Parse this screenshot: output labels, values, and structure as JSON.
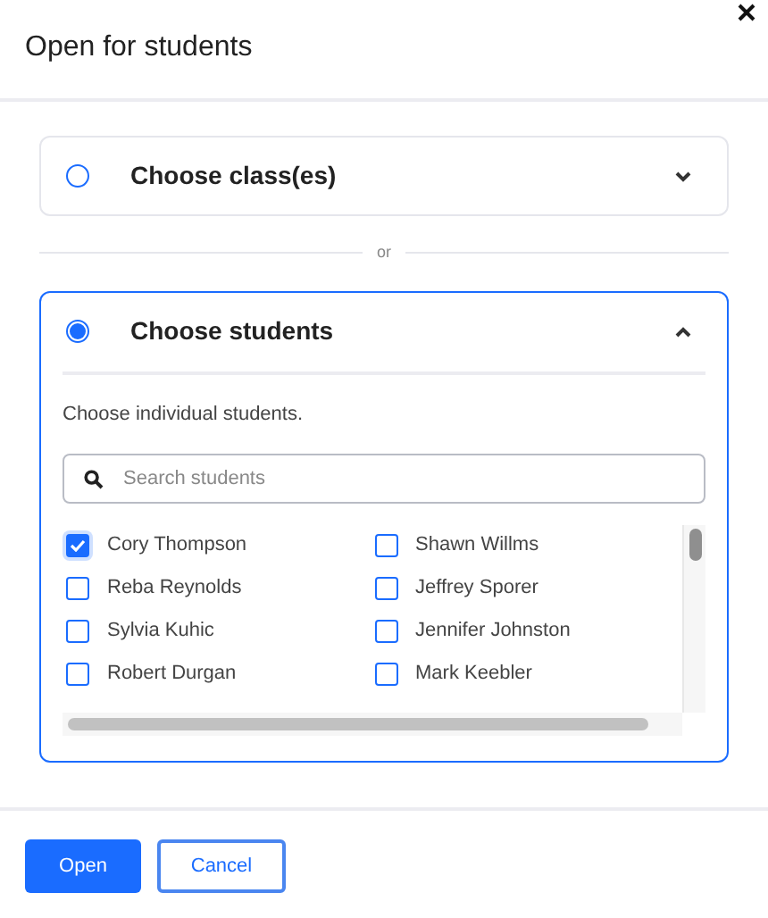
{
  "dialog": {
    "title": "Open for students"
  },
  "options": [
    {
      "label": "Choose class(es)",
      "selected": false,
      "expanded": false
    },
    {
      "label": "Choose students",
      "selected": true,
      "expanded": true,
      "description": "Choose individual students.",
      "search": {
        "placeholder": "Search students"
      },
      "students": [
        {
          "name": "Cory Thompson",
          "checked": true
        },
        {
          "name": "Shawn Willms",
          "checked": false
        },
        {
          "name": "Reba Reynolds",
          "checked": false
        },
        {
          "name": "Jeffrey Sporer",
          "checked": false
        },
        {
          "name": "Sylvia Kuhic",
          "checked": false
        },
        {
          "name": "Jennifer Johnston",
          "checked": false
        },
        {
          "name": "Robert Durgan",
          "checked": false
        },
        {
          "name": "Mark Keebler",
          "checked": false
        }
      ]
    }
  ],
  "separator": "or",
  "buttons": [
    {
      "label": "Open",
      "kind": "primary"
    },
    {
      "label": "Cancel",
      "kind": "secondary"
    }
  ]
}
